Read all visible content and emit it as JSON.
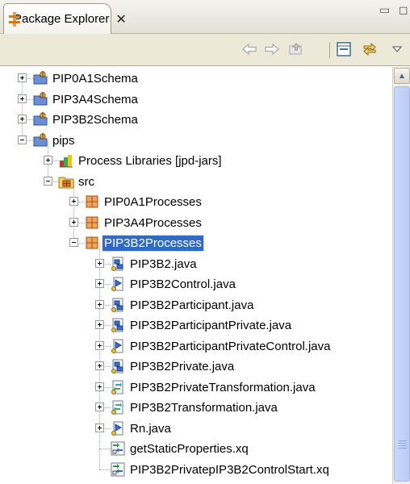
{
  "view": {
    "tab_title": "Package Explorer",
    "close_glyph": "✕",
    "minimize_glyph": "▭",
    "maximize_glyph": "◻"
  },
  "toolbar": {
    "back_icon": "back-arrow-icon",
    "forward_icon": "forward-arrow-icon",
    "up_icon": "up-folder-icon",
    "collapse_icon": "collapse-all-icon",
    "link_icon": "link-with-editor-icon",
    "menu_icon": "view-menu-icon"
  },
  "tree": {
    "items": [
      {
        "label": "PIP0A1Schema",
        "icon": "project-icon",
        "expanded": false
      },
      {
        "label": "PIP3A4Schema",
        "icon": "project-icon",
        "expanded": false
      },
      {
        "label": "PIP3B2Schema",
        "icon": "project-icon",
        "expanded": false
      },
      {
        "label": "pips",
        "icon": "project-icon",
        "expanded": true
      },
      {
        "label": "Process Libraries [jpd-jars]",
        "icon": "library-icon",
        "expanded": false
      },
      {
        "label": "src",
        "icon": "source-folder-icon",
        "expanded": true
      },
      {
        "label": "PIP0A1Processes",
        "icon": "package-icon",
        "expanded": false
      },
      {
        "label": "PIP3A4Processes",
        "icon": "package-icon",
        "expanded": false
      },
      {
        "label": "PIP3B2Processes",
        "icon": "package-icon",
        "expanded": true,
        "selected": true
      },
      {
        "label": "PIP3B2.java",
        "icon": "process-file-icon",
        "expanded": false
      },
      {
        "label": "PIP3B2Control.java",
        "icon": "control-file-icon",
        "expanded": false
      },
      {
        "label": "PIP3B2Participant.java",
        "icon": "process-file-icon",
        "expanded": false
      },
      {
        "label": "PIP3B2ParticipantPrivate.java",
        "icon": "process-file-icon",
        "expanded": false
      },
      {
        "label": "PIP3B2ParticipantPrivateControl.java",
        "icon": "control-file-icon",
        "expanded": false
      },
      {
        "label": "PIP3B2Private.java",
        "icon": "process-file-icon",
        "expanded": false
      },
      {
        "label": "PIP3B2PrivateTransformation.java",
        "icon": "transformation-file-icon",
        "expanded": false
      },
      {
        "label": "PIP3B2Transformation.java",
        "icon": "transformation-file-icon",
        "expanded": false
      },
      {
        "label": "Rn.java",
        "icon": "control-file-icon",
        "expanded": false
      },
      {
        "label": "getStaticProperties.xq",
        "icon": "xquery-file-icon"
      },
      {
        "label": "PIP3B2PrivatepIP3B2ControlStart.xq",
        "icon": "xquery-file-icon"
      }
    ]
  },
  "colors": {
    "selection": "#3169c6",
    "toolbar_bg": "#ece9d8"
  }
}
